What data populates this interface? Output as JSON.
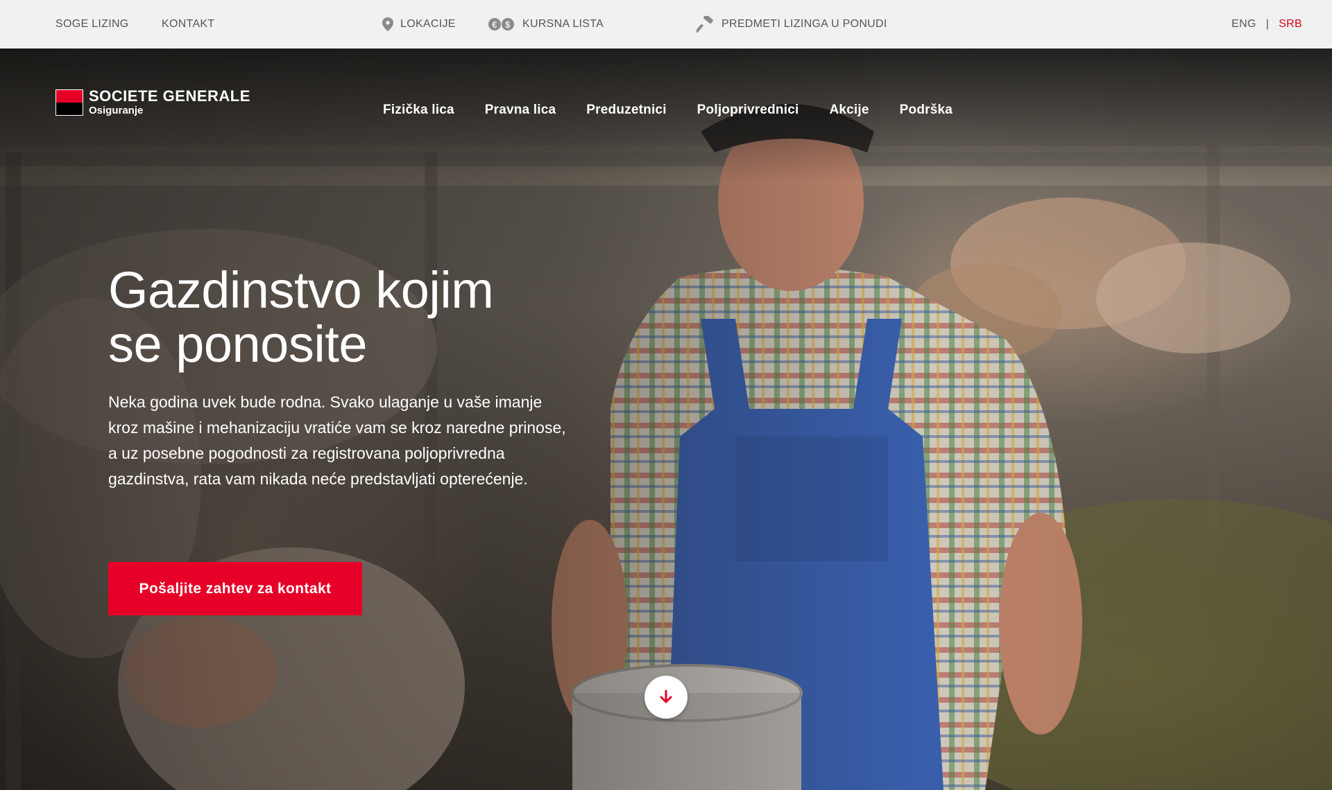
{
  "topbar": {
    "links": [
      "SOGE LIZING",
      "KONTAKT"
    ],
    "locations": "LOKACIJE",
    "rates": "KURSNA LISTA",
    "leasing_items": "PREDMETI LIZINGA U PONUDI",
    "lang_en": "ENG",
    "lang_separator": "|",
    "lang_sr": "SRB"
  },
  "logo": {
    "line1": "SOCIETE GENERALE",
    "line2": "Osiguranje"
  },
  "nav": [
    "Fizička lica",
    "Pravna lica",
    "Preduzetnici",
    "Poljoprivrednici",
    "Akcije",
    "Podrška"
  ],
  "hero": {
    "title_line1": "Gazdinstvo kojim",
    "title_line2": "se ponosite",
    "lead": "Neka godina uvek bude rodna. Svako ulaganje u vaše imanje kroz mašine i mehanizaciju vratiće vam se kroz naredne prinose, a uz posebne pogodnosti za registrovana poljoprivredna gazdinstva, rata vam nikada neće predstavljati opterećenje.",
    "cta": "Pošaljite zahtev za kontakt"
  },
  "icons": {
    "location": "map-pin-icon",
    "rates": "currency-icon",
    "leasing": "hammer-icon",
    "scroll": "arrow-down-icon"
  },
  "colors": {
    "brand_red": "#e60028",
    "active_lang": "#d6001c",
    "topbar_bg": "#f1f1f1"
  }
}
